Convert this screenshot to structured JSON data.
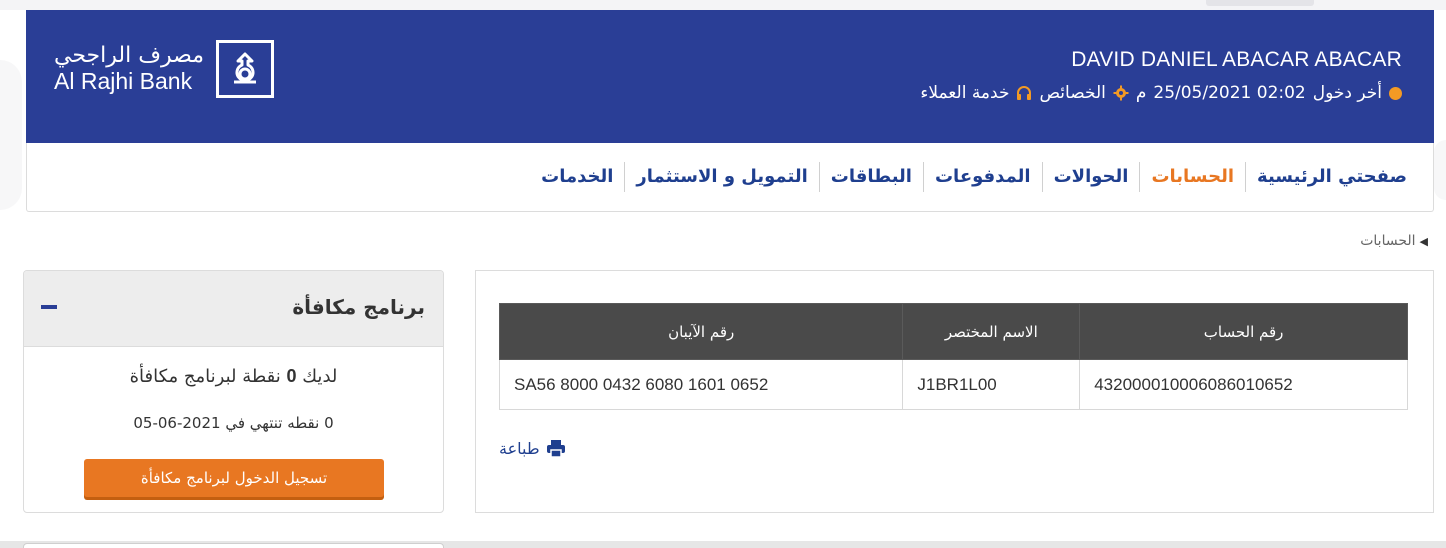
{
  "colors": {
    "header_bg": "#2a3e96",
    "accent_orange": "#e87722",
    "nav_text": "#1f3f8f",
    "table_header_bg": "#4a4a4a"
  },
  "header": {
    "username": "DAVID DANIEL ABACAR ABACAR",
    "last_login_label": "أخر دخول",
    "last_login_datetime": "25/05/2021 02:02",
    "last_login_ampm": "م",
    "preferences_label": "الخصائص",
    "customer_service_label": "خدمة العملاء",
    "logo": {
      "arabic": "مصرف الراجحي",
      "english": "Al Rajhi Bank",
      "icon": "al-rajhi-logo-icon"
    }
  },
  "nav": {
    "items": [
      {
        "label": "صفحتي الرئيسية",
        "active": false
      },
      {
        "label": "الحسابات",
        "active": true
      },
      {
        "label": "الحوالات",
        "active": false
      },
      {
        "label": "المدفوعات",
        "active": false
      },
      {
        "label": "البطاقات",
        "active": false
      },
      {
        "label": "التمويل و الاستثمار",
        "active": false
      },
      {
        "label": "الخدمات",
        "active": false
      }
    ]
  },
  "breadcrumb": {
    "current": "الحسابات"
  },
  "accounts_table": {
    "headers": {
      "account_number": "رقم الحساب",
      "nickname": "الاسم المختصر",
      "iban": "رقم الآيبان"
    },
    "rows": [
      {
        "account_number": "432000010006086010652",
        "nickname": "J1BR1L00",
        "iban": "SA56 8000 0432 6080 1601 0652"
      }
    ]
  },
  "print": {
    "label": "طباعة",
    "icon": "printer-icon"
  },
  "rewards": {
    "title": "برنامج مكافأة",
    "points_prefix": "لديك",
    "points_value": "0",
    "points_suffix": "نقطة لبرنامج مكافأة",
    "expiry_points": "0",
    "expiry_text": "نقطه تنتهي في",
    "expiry_date": "2021-06-05",
    "enroll_button": "تسجيل الدخول لبرنامج مكافأة"
  }
}
